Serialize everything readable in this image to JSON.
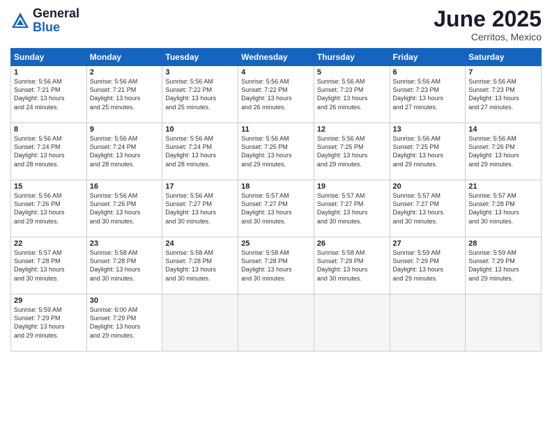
{
  "header": {
    "logo_general": "General",
    "logo_blue": "Blue",
    "month_title": "June 2025",
    "location": "Cerritos, Mexico"
  },
  "weekdays": [
    "Sunday",
    "Monday",
    "Tuesday",
    "Wednesday",
    "Thursday",
    "Friday",
    "Saturday"
  ],
  "weeks": [
    [
      {
        "day": "1",
        "info": "Sunrise: 5:56 AM\nSunset: 7:21 PM\nDaylight: 13 hours\nand 24 minutes."
      },
      {
        "day": "2",
        "info": "Sunrise: 5:56 AM\nSunset: 7:21 PM\nDaylight: 13 hours\nand 25 minutes."
      },
      {
        "day": "3",
        "info": "Sunrise: 5:56 AM\nSunset: 7:22 PM\nDaylight: 13 hours\nand 25 minutes."
      },
      {
        "day": "4",
        "info": "Sunrise: 5:56 AM\nSunset: 7:22 PM\nDaylight: 13 hours\nand 26 minutes."
      },
      {
        "day": "5",
        "info": "Sunrise: 5:56 AM\nSunset: 7:23 PM\nDaylight: 13 hours\nand 26 minutes."
      },
      {
        "day": "6",
        "info": "Sunrise: 5:56 AM\nSunset: 7:23 PM\nDaylight: 13 hours\nand 27 minutes."
      },
      {
        "day": "7",
        "info": "Sunrise: 5:56 AM\nSunset: 7:23 PM\nDaylight: 13 hours\nand 27 minutes."
      }
    ],
    [
      {
        "day": "8",
        "info": "Sunrise: 5:56 AM\nSunset: 7:24 PM\nDaylight: 13 hours\nand 28 minutes."
      },
      {
        "day": "9",
        "info": "Sunrise: 5:56 AM\nSunset: 7:24 PM\nDaylight: 13 hours\nand 28 minutes."
      },
      {
        "day": "10",
        "info": "Sunrise: 5:56 AM\nSunset: 7:24 PM\nDaylight: 13 hours\nand 28 minutes."
      },
      {
        "day": "11",
        "info": "Sunrise: 5:56 AM\nSunset: 7:25 PM\nDaylight: 13 hours\nand 29 minutes."
      },
      {
        "day": "12",
        "info": "Sunrise: 5:56 AM\nSunset: 7:25 PM\nDaylight: 13 hours\nand 29 minutes."
      },
      {
        "day": "13",
        "info": "Sunrise: 5:56 AM\nSunset: 7:25 PM\nDaylight: 13 hours\nand 29 minutes."
      },
      {
        "day": "14",
        "info": "Sunrise: 5:56 AM\nSunset: 7:26 PM\nDaylight: 13 hours\nand 29 minutes."
      }
    ],
    [
      {
        "day": "15",
        "info": "Sunrise: 5:56 AM\nSunset: 7:26 PM\nDaylight: 13 hours\nand 29 minutes."
      },
      {
        "day": "16",
        "info": "Sunrise: 5:56 AM\nSunset: 7:26 PM\nDaylight: 13 hours\nand 30 minutes."
      },
      {
        "day": "17",
        "info": "Sunrise: 5:56 AM\nSunset: 7:27 PM\nDaylight: 13 hours\nand 30 minutes."
      },
      {
        "day": "18",
        "info": "Sunrise: 5:57 AM\nSunset: 7:27 PM\nDaylight: 13 hours\nand 30 minutes."
      },
      {
        "day": "19",
        "info": "Sunrise: 5:57 AM\nSunset: 7:27 PM\nDaylight: 13 hours\nand 30 minutes."
      },
      {
        "day": "20",
        "info": "Sunrise: 5:57 AM\nSunset: 7:27 PM\nDaylight: 13 hours\nand 30 minutes."
      },
      {
        "day": "21",
        "info": "Sunrise: 5:57 AM\nSunset: 7:28 PM\nDaylight: 13 hours\nand 30 minutes."
      }
    ],
    [
      {
        "day": "22",
        "info": "Sunrise: 5:57 AM\nSunset: 7:28 PM\nDaylight: 13 hours\nand 30 minutes."
      },
      {
        "day": "23",
        "info": "Sunrise: 5:58 AM\nSunset: 7:28 PM\nDaylight: 13 hours\nand 30 minutes."
      },
      {
        "day": "24",
        "info": "Sunrise: 5:58 AM\nSunset: 7:28 PM\nDaylight: 13 hours\nand 30 minutes."
      },
      {
        "day": "25",
        "info": "Sunrise: 5:58 AM\nSunset: 7:28 PM\nDaylight: 13 hours\nand 30 minutes."
      },
      {
        "day": "26",
        "info": "Sunrise: 5:58 AM\nSunset: 7:29 PM\nDaylight: 13 hours\nand 30 minutes."
      },
      {
        "day": "27",
        "info": "Sunrise: 5:59 AM\nSunset: 7:29 PM\nDaylight: 13 hours\nand 29 minutes."
      },
      {
        "day": "28",
        "info": "Sunrise: 5:59 AM\nSunset: 7:29 PM\nDaylight: 13 hours\nand 29 minutes."
      }
    ],
    [
      {
        "day": "29",
        "info": "Sunrise: 5:59 AM\nSunset: 7:29 PM\nDaylight: 13 hours\nand 29 minutes."
      },
      {
        "day": "30",
        "info": "Sunrise: 6:00 AM\nSunset: 7:29 PM\nDaylight: 13 hours\nand 29 minutes."
      },
      {
        "day": "",
        "info": ""
      },
      {
        "day": "",
        "info": ""
      },
      {
        "day": "",
        "info": ""
      },
      {
        "day": "",
        "info": ""
      },
      {
        "day": "",
        "info": ""
      }
    ]
  ]
}
